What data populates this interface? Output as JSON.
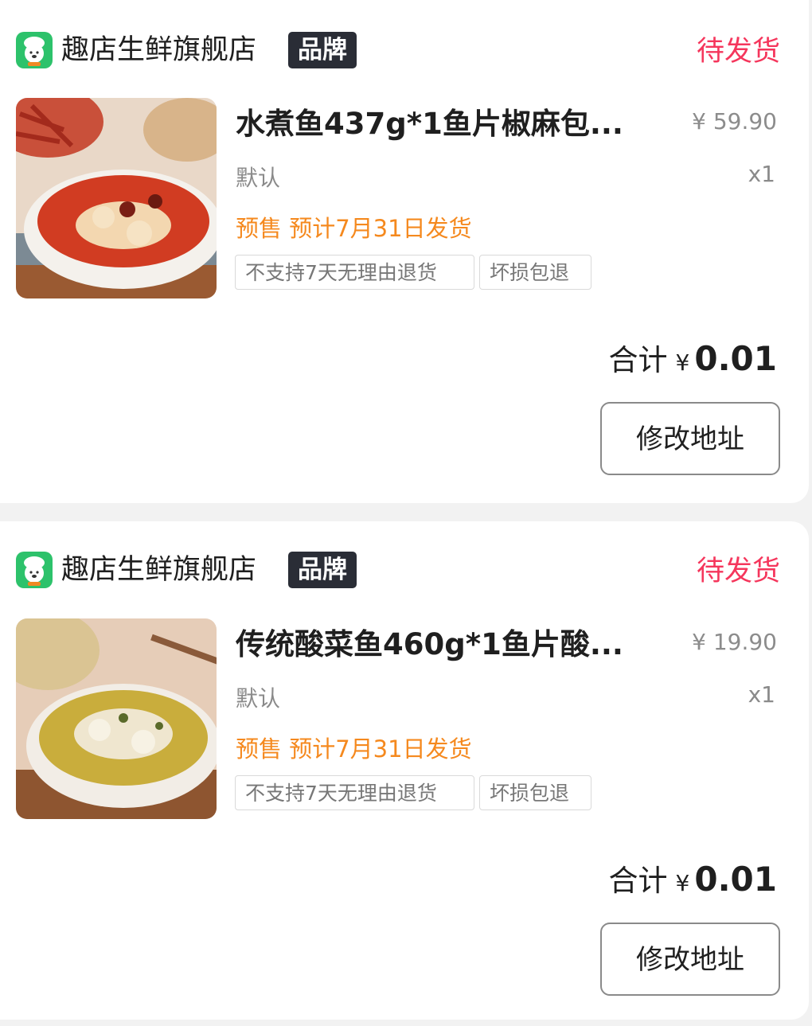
{
  "orders": [
    {
      "store": {
        "name": "趣店生鲜旗舰店",
        "badge": "品牌",
        "logo_icon": "sheep-chef-icon"
      },
      "status": "待发货",
      "item": {
        "title": "水煮鱼437g*1鱼片椒麻包...",
        "price": "¥ 59.90",
        "spec": "默认",
        "quantity": "x1",
        "presale": "预售 预计7月31日发货",
        "tags": [
          "不支持7天无理由退货",
          "坏损包退"
        ]
      },
      "total": {
        "label": "合计",
        "currency": "¥",
        "amount": "0.01"
      },
      "action_label": "修改地址"
    },
    {
      "store": {
        "name": "趣店生鲜旗舰店",
        "badge": "品牌",
        "logo_icon": "sheep-chef-icon"
      },
      "status": "待发货",
      "item": {
        "title": "传统酸菜鱼460g*1鱼片酸...",
        "price": "¥ 19.90",
        "spec": "默认",
        "quantity": "x1",
        "presale": "预售 预计7月31日发货",
        "tags": [
          "不支持7天无理由退货",
          "坏损包退"
        ]
      },
      "total": {
        "label": "合计",
        "currency": "¥",
        "amount": "0.01"
      },
      "action_label": "修改地址"
    }
  ],
  "colors": {
    "status": "#f5365c",
    "presale": "#f5891e",
    "brand_badge_bg": "#2a2d36",
    "logo_bg": "#2dc26b"
  }
}
